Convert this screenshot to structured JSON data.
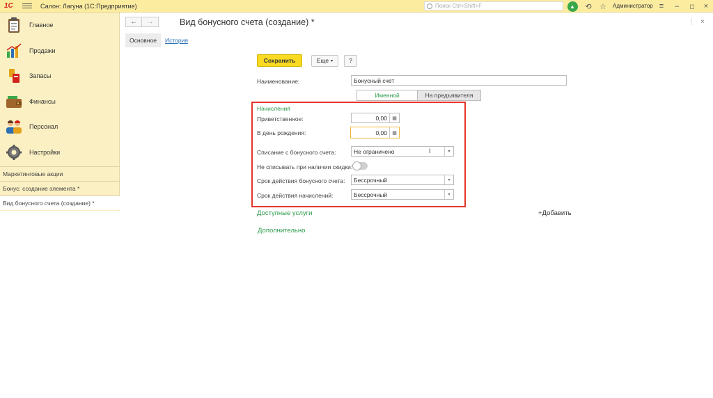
{
  "app": {
    "logo": "1С",
    "title": "Салон: Лагуна  (1С:Предприятие)",
    "search_placeholder": "Поиск Ctrl+Shift+F",
    "user": "Администратор"
  },
  "sidebar": {
    "items": [
      {
        "label": "Главное",
        "icon": "clipboard-icon"
      },
      {
        "label": "Продажи",
        "icon": "sales-chart-icon"
      },
      {
        "label": "Запасы",
        "icon": "inventory-icon"
      },
      {
        "label": "Финансы",
        "icon": "wallet-icon"
      },
      {
        "label": "Персонал",
        "icon": "people-icon"
      },
      {
        "label": "Настройки",
        "icon": "gear-icon"
      }
    ],
    "open_windows": [
      {
        "label": "Маркетинговые акции"
      },
      {
        "label": "Бонус: создание элемента *"
      },
      {
        "label": "Вид бонусного счета (создание) *"
      }
    ]
  },
  "form": {
    "title": "Вид бонусного счета (создание) *",
    "tabs": [
      {
        "label": "Основное"
      },
      {
        "label": "История"
      }
    ],
    "save_label": "Сохранить",
    "more_label": "Еще",
    "help_label": "?",
    "name_label": "Наименование:",
    "name_value": "Бонусный счет",
    "kind_options": [
      "Именной",
      "На предъявителя"
    ],
    "accruals_group_title": "Начисления",
    "welcome_label": "Приветственное:",
    "welcome_value": "0,00",
    "birthday_label": "В день рождения:",
    "birthday_value": "0,00",
    "writeoff_label": "Списание с бонусного счета:",
    "writeoff_value": "Не ограничено",
    "no_writeoff_label": "Не списывать при наличии скидки:",
    "no_writeoff_on": false,
    "account_term_label": "Срок действия бонусного счета:",
    "account_term_value": "Бессрочный",
    "accrual_term_label": "Срок действия начислений:",
    "accrual_term_value": "Бессрочный",
    "services_section": "Доступные услуги",
    "add_label": "+Добавить",
    "additional_section": "Дополнительно"
  },
  "colors": {
    "topbar": "#fbeca0",
    "sidebar": "#fbf0c3",
    "accent_green": "#2d9b4a",
    "save_yellow": "#fadb22",
    "highlight_red": "#e3372b"
  }
}
